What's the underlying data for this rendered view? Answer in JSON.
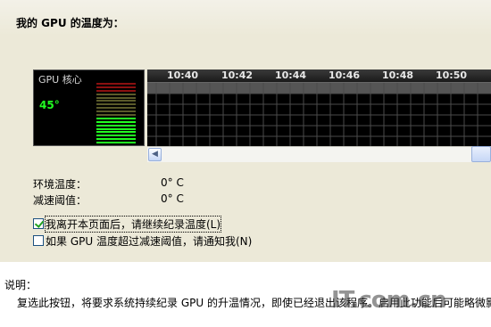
{
  "page": {
    "title": "我的 GPU 的温度为："
  },
  "gauge": {
    "label": "GPU 核心",
    "temperature": "45°",
    "level_fraction": 0.45
  },
  "graph": {
    "time_labels": [
      "10:40",
      "10:42",
      "10:44",
      "10:46",
      "10:48",
      "10:50"
    ]
  },
  "info": {
    "ambient_label": "环境温度：",
    "ambient_value": "0° C",
    "slowdown_label": "减速阈值：",
    "slowdown_value": "0° C"
  },
  "options": {
    "continue_logging": {
      "label": "我离开本页面后，请继续纪录温度(L)",
      "checked": true
    },
    "notify_slowdown": {
      "label": "如果 GPU 温度超过减速阈值，请通知我(N)",
      "checked": false
    }
  },
  "description": {
    "title": "说明：",
    "text": "复选此按钮，将要求系统持续纪录 GPU 的升温情况，即使已经退出该程序。启用此功能后可能略微影"
  },
  "watermark": {
    "text": "IT.com.cn"
  },
  "colors": {
    "gauge_green": "#22ff22",
    "gauge_red": "#8b1010",
    "graph_bg": "#000000",
    "panel_bg": "#ece9d8"
  }
}
